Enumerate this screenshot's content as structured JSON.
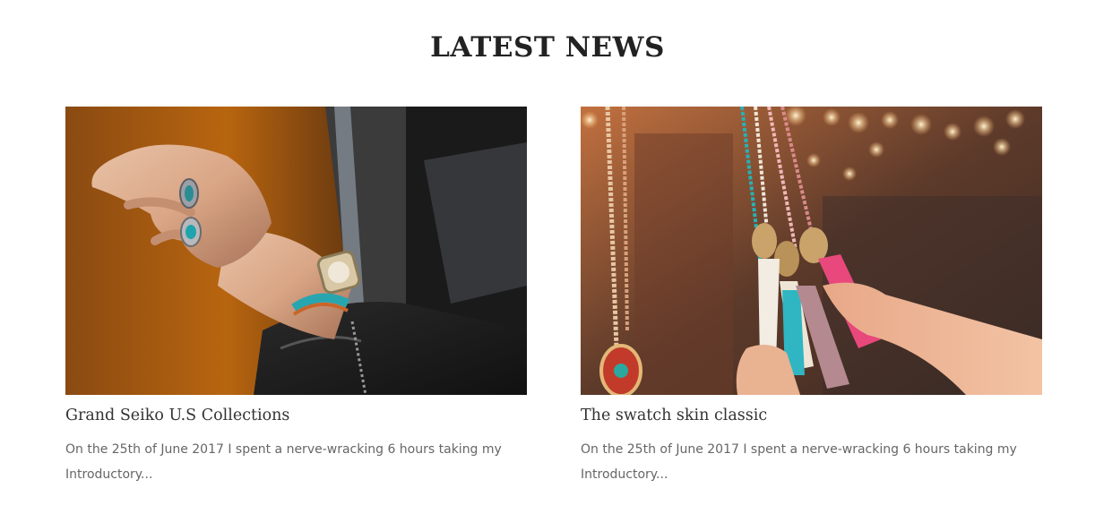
{
  "section": {
    "title": "LATEST NEWS"
  },
  "posts": [
    {
      "title": "Grand Seiko U.S Collections",
      "excerpt": "On the 25th of June 2017 I spent a nerve-wracking 6 hours taking my Introductory...",
      "image": "hand-with-rings-and-watch-photo"
    },
    {
      "title": "The swatch skin classic",
      "excerpt": "On the 25th of June 2017 I spent a nerve-wracking 6 hours taking my Introductory...",
      "image": "tassel-necklaces-market-photo"
    }
  ],
  "colors": {
    "heading": "#222222",
    "title": "#333333",
    "body": "#666666",
    "background": "#ffffff"
  }
}
